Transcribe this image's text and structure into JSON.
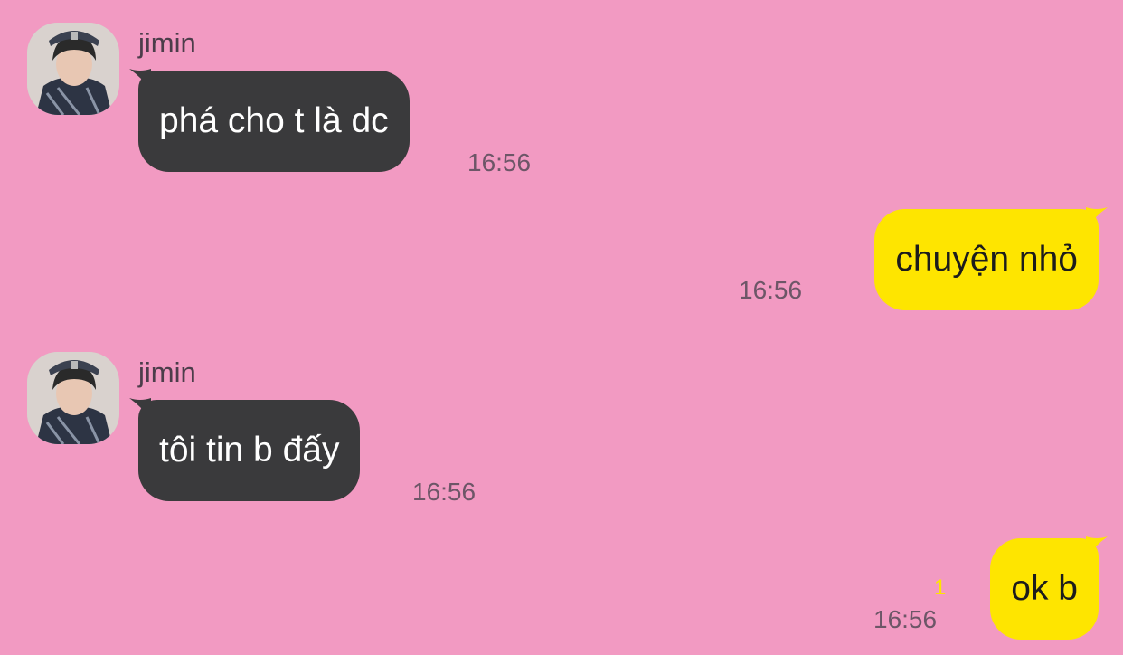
{
  "messages": [
    {
      "direction": "incoming",
      "sender": "jimin",
      "text": "phá cho t là dc",
      "time": "16:56"
    },
    {
      "direction": "outgoing",
      "text": "chuyện nhỏ",
      "time": "16:56"
    },
    {
      "direction": "incoming",
      "sender": "jimin",
      "text": "tôi tin b đấy",
      "time": "16:56"
    },
    {
      "direction": "outgoing",
      "text": "ok b",
      "time": "16:56",
      "unread": "1"
    }
  ],
  "colors": {
    "background": "#f29ac2",
    "incoming_bubble": "#3a3a3c",
    "outgoing_bubble": "#fee500",
    "unread_count": "#fee500"
  },
  "icons": {
    "avatar": "profile-photo"
  }
}
